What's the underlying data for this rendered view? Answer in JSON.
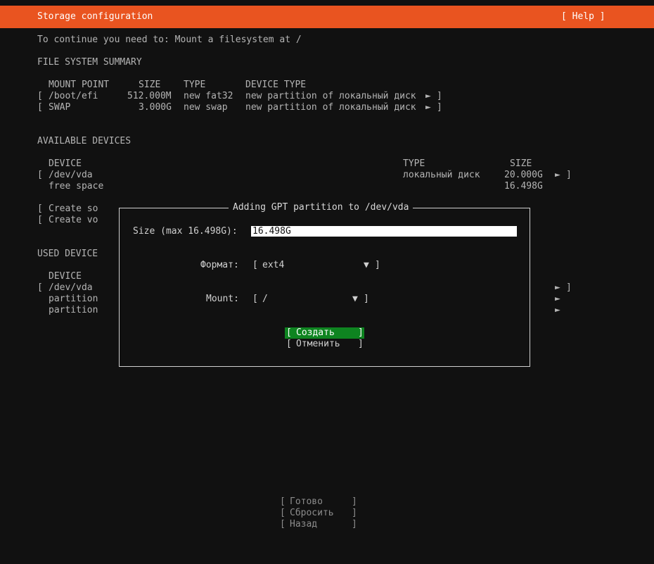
{
  "header": {
    "title": "Storage configuration",
    "help": "[ Help ]"
  },
  "instruction": "To continue you need to: Mount a filesystem at /",
  "fs_summary": {
    "heading": "FILE SYSTEM SUMMARY",
    "columns": [
      "MOUNT POINT",
      "SIZE",
      "TYPE",
      "DEVICE TYPE"
    ],
    "rows": [
      {
        "mount": "/boot/efi",
        "size": "512.000M",
        "type": "new fat32",
        "device_type": "new partition of локальный диск"
      },
      {
        "mount": "SWAP",
        "size": "3.000G",
        "type": "new swap",
        "device_type": "new partition of локальный диск"
      }
    ]
  },
  "available": {
    "heading": "AVAILABLE DEVICES",
    "columns": [
      "DEVICE",
      "TYPE",
      "SIZE"
    ],
    "rows": [
      {
        "device": "/dev/vda",
        "type": "локальный диск",
        "size": "20.000G"
      },
      {
        "device": "free space",
        "type": "",
        "size": "16.498G"
      }
    ],
    "actions": [
      "Create so",
      "Create vo"
    ]
  },
  "used": {
    "heading": "USED DEVICE",
    "column": "DEVICE",
    "rows": [
      "/dev/vda",
      "partition",
      "partition"
    ]
  },
  "dialog": {
    "title": "Adding GPT partition to /dev/vda",
    "size_label": "Size (max 16.498G):",
    "size_value": "16.498G",
    "format_label": "Формат:",
    "format_value": "ext4",
    "mount_label": "Mount:",
    "mount_value": "/",
    "create_label": "Создать",
    "cancel_label": "Отменить"
  },
  "footer": {
    "done": "Готово",
    "reset": "Сбросить",
    "back": "Назад"
  },
  "glyphs": {
    "arrow_right": "►",
    "arrow_down": "▼"
  },
  "colors": {
    "accent": "#e95420",
    "focus": "#0e8420",
    "background": "#111111"
  }
}
